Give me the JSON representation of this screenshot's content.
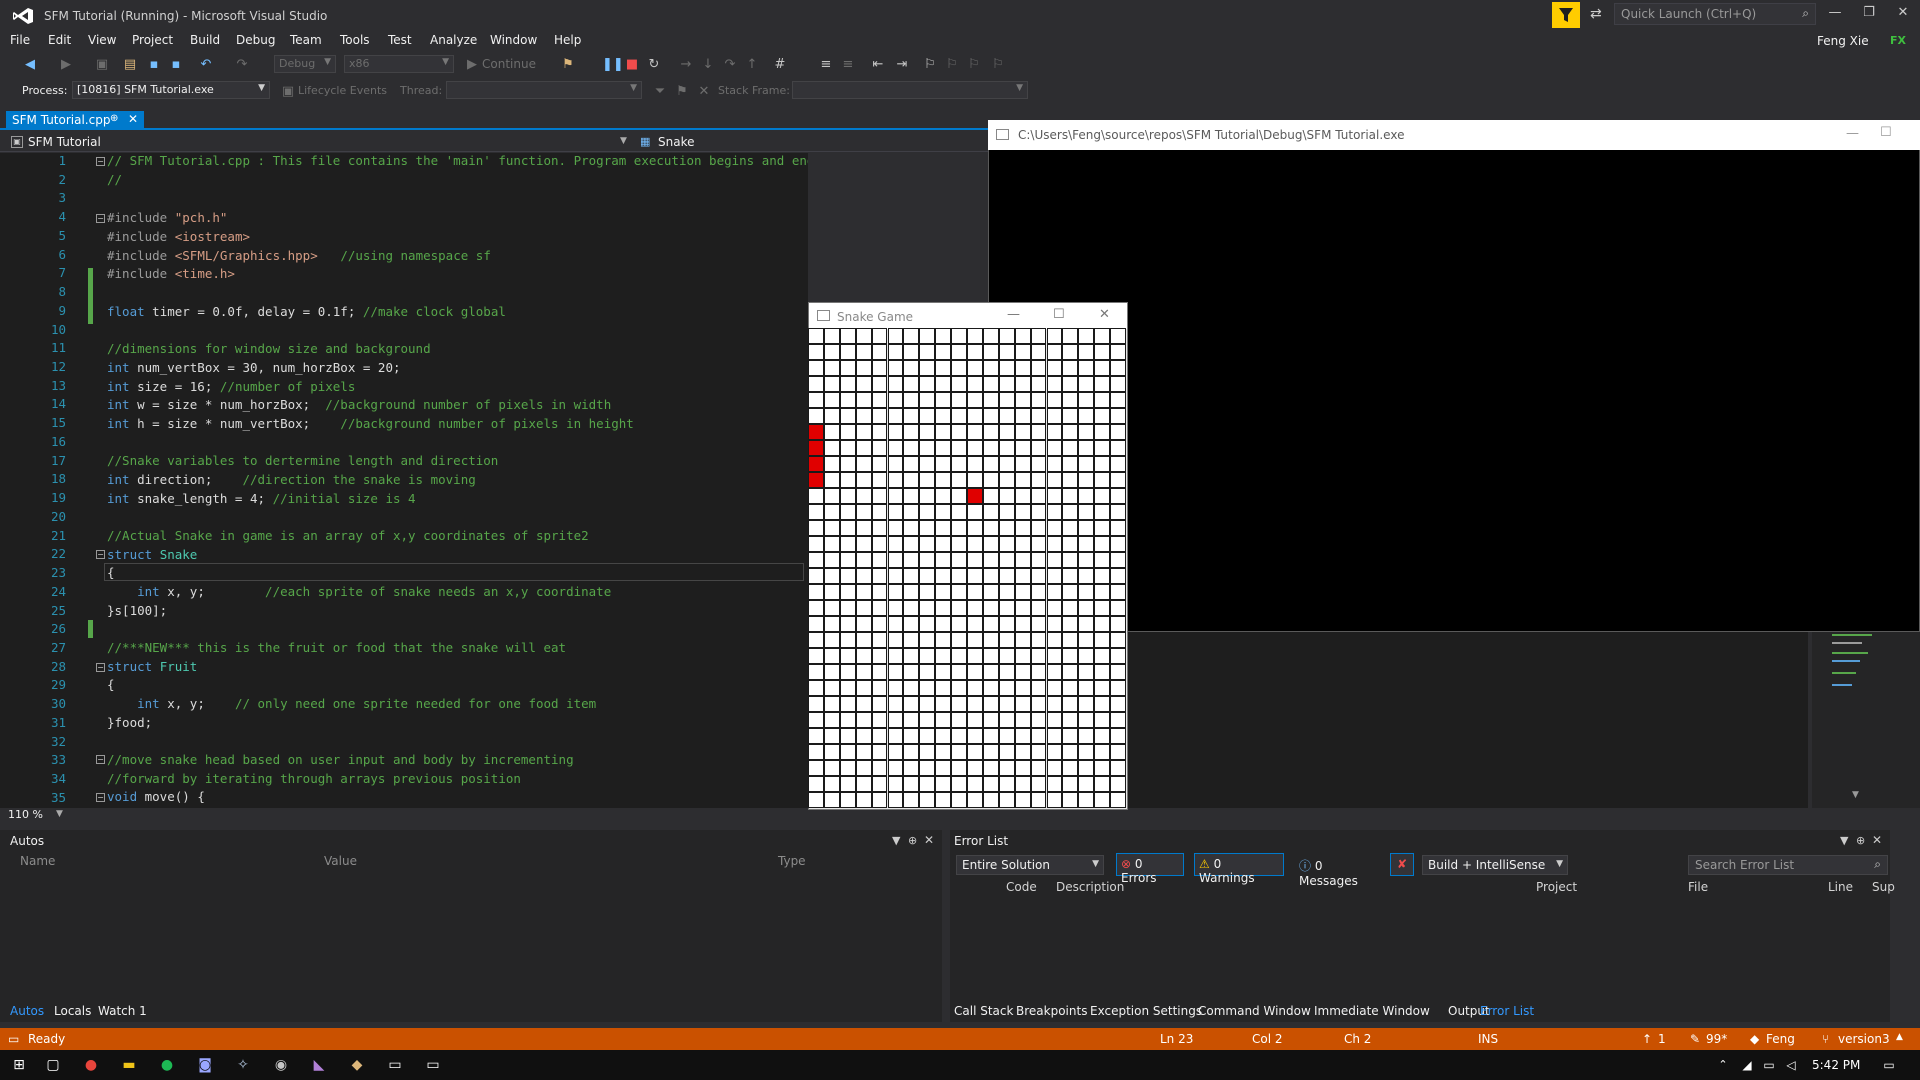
{
  "window": {
    "title": "SFM Tutorial (Running) - Microsoft Visual Studio",
    "quick_launch_placeholder": "Quick Launch (Ctrl+Q)",
    "user": "Feng Xie",
    "user_initials": "FX"
  },
  "menu": [
    "File",
    "Edit",
    "View",
    "Project",
    "Build",
    "Debug",
    "Team",
    "Tools",
    "Test",
    "Analyze",
    "Window",
    "Help"
  ],
  "toolbar": {
    "config": "Debug",
    "platform": "x86",
    "continue_label": "Continue"
  },
  "debug_location": {
    "process_label": "Process:",
    "process_value": "[10816] SFM Tutorial.exe",
    "lifecycle_label": "Lifecycle Events",
    "thread_label": "Thread:",
    "stack_frame_label": "Stack Frame:"
  },
  "doc_tab": {
    "label": "SFM Tutorial.cpp",
    "pin": "⊕",
    "close": "✕"
  },
  "nav": {
    "scope": "SFM Tutorial",
    "symbol": "Snake"
  },
  "editor": {
    "line_numbers": [
      "1",
      "2",
      "3",
      "4",
      "5",
      "6",
      "7",
      "8",
      "9",
      "10",
      "11",
      "12",
      "13",
      "14",
      "15",
      "16",
      "17",
      "18",
      "19",
      "20",
      "21",
      "22",
      "23",
      "24",
      "25",
      "26",
      "27",
      "28",
      "29",
      "30",
      "31",
      "32",
      "33",
      "34",
      "35"
    ],
    "zoom": "110 %"
  },
  "console": {
    "title": "C:\\Users\\Feng\\source\\repos\\SFM Tutorial\\Debug\\SFM Tutorial.exe"
  },
  "snake_game": {
    "title": "Snake Game",
    "grid_cols": 20,
    "grid_rows": 30,
    "snake_cells": [
      [
        0,
        6
      ],
      [
        0,
        7
      ],
      [
        0,
        8
      ],
      [
        0,
        9
      ]
    ],
    "food_cell": [
      10,
      10
    ]
  },
  "autos": {
    "title": "Autos",
    "columns": [
      "Name",
      "Value",
      "Type"
    ],
    "tabs": [
      "Autos",
      "Locals",
      "Watch 1"
    ]
  },
  "error_list": {
    "title": "Error List",
    "scope": "Entire Solution",
    "errors": "0 Errors",
    "warnings": "0 Warnings",
    "messages": "0 Messages",
    "build_filter": "Build + IntelliSense",
    "search_placeholder": "Search Error List",
    "columns": [
      "Code",
      "Description",
      "Project",
      "File",
      "Line",
      "Sup"
    ],
    "tabs": [
      "Call Stack",
      "Breakpoints",
      "Exception Settings",
      "Command Window",
      "Immediate Window",
      "Output",
      "Error List"
    ]
  },
  "status": {
    "ready": "Ready",
    "ln": "Ln 23",
    "col": "Col 2",
    "ch": "Ch 2",
    "ins": "INS",
    "up": "1",
    "pencil": "99*",
    "user": "Feng",
    "branch": "version3"
  },
  "taskbar": {
    "time": "5:42 PM"
  },
  "colors": {
    "accent": "#007acc",
    "status": "#ca5100",
    "snake": "#e00000",
    "grid_line": "#1a1a1a"
  }
}
